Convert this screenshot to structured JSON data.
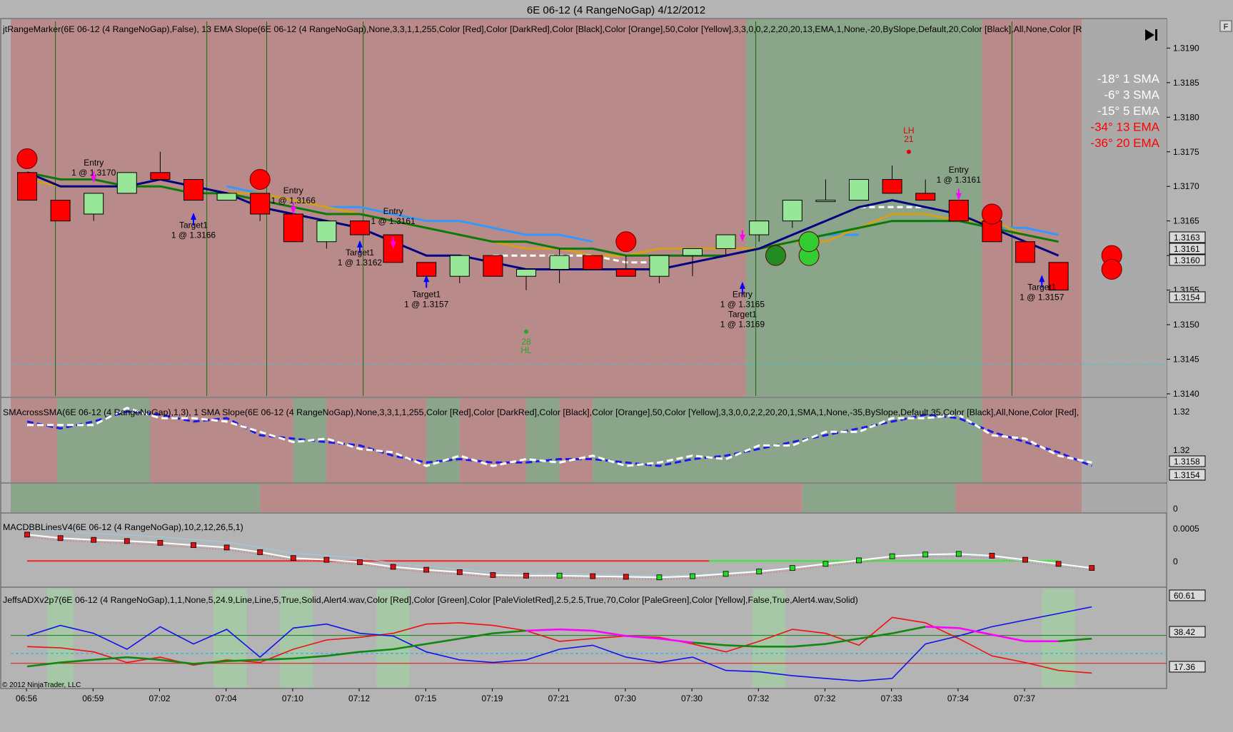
{
  "window": {
    "title": "6E 06-12 (4 RangeNoGap)  4/12/2012",
    "copyright": "© 2012 NinjaTrader, LLC",
    "corner_button": "F"
  },
  "colors": {
    "bg": "#b4b4b4",
    "bear_zone": "#b98a8a",
    "bull_zone": "#8ba58b",
    "gray_zone": "#aaaaaa",
    "up_candle": "#98e698",
    "down_candle": "#ff0000",
    "ema13": "#0a7a0a",
    "ema20": "#d4a017",
    "sma1": "#000080",
    "sma3": "#ffffff",
    "ema5": "#f5a08a",
    "blue_line": "#3399ff",
    "magenta": "#ff00ff",
    "arrow_blue": "#0000ff"
  },
  "chart_data": [
    {
      "panel": "price",
      "type": "candlestick",
      "label": "jtRangeMarker(6E 06-12 (4 RangeNoGap),False),  13 EMA Slope(6E 06-12 (4 RangeNoGap),None,3,3,1,1,255,Color [Red],Color [DarkRed],Color [Black],Color [Orange],50,Color [Yellow],3,3,0,0,2,2,20,20,13,EMA,1,None,-20,BySlope,Default,20,Color [Black],All,None,Color [R",
      "x_ticks": [
        "06:56",
        "06:59",
        "07:02",
        "07:04",
        "07:10",
        "07:12",
        "07:15",
        "07:19",
        "07:21",
        "07:30",
        "07:30",
        "07:32",
        "07:32",
        "07:33",
        "07:34",
        "07:37"
      ],
      "y_ticks": [
        "1.3190",
        "1.3185",
        "1.3180",
        "1.3175",
        "1.3170",
        "1.3165",
        "1.3160",
        "1.3155",
        "1.3150",
        "1.3145",
        "1.3140"
      ],
      "ylim": [
        1.314,
        1.3192
      ],
      "price_flags": [
        "1.3163",
        "1.3161",
        "1.3160",
        "1.3154"
      ],
      "zones": [
        {
          "from": 0,
          "to": 22.1,
          "kind": "bear"
        },
        {
          "from": 22.1,
          "to": 29.2,
          "kind": "bull"
        },
        {
          "from": 29.2,
          "to": 32.2,
          "kind": "bear"
        },
        {
          "from": 32.2,
          "to": 35.0,
          "kind": "gray"
        }
      ],
      "bars": [
        {
          "o": 1.3172,
          "h": 1.3172,
          "l": 1.3168,
          "c": 1.3168
        },
        {
          "o": 1.3168,
          "h": 1.3168,
          "l": 1.3165,
          "c": 1.3165
        },
        {
          "o": 1.3166,
          "h": 1.3169,
          "l": 1.3165,
          "c": 1.3169
        },
        {
          "o": 1.3169,
          "h": 1.3172,
          "l": 1.3169,
          "c": 1.3172
        },
        {
          "o": 1.3172,
          "h": 1.3175,
          "l": 1.3171,
          "c": 1.3171
        },
        {
          "o": 1.3171,
          "h": 1.3171,
          "l": 1.3168,
          "c": 1.3168
        },
        {
          "o": 1.3168,
          "h": 1.3169,
          "l": 1.3168,
          "c": 1.3169
        },
        {
          "o": 1.3169,
          "h": 1.3169,
          "l": 1.3165,
          "c": 1.3166
        },
        {
          "o": 1.3166,
          "h": 1.3166,
          "l": 1.3162,
          "c": 1.3162
        },
        {
          "o": 1.3162,
          "h": 1.3165,
          "l": 1.3161,
          "c": 1.3165
        },
        {
          "o": 1.3165,
          "h": 1.3165,
          "l": 1.3163,
          "c": 1.3163
        },
        {
          "o": 1.3163,
          "h": 1.3163,
          "l": 1.3159,
          "c": 1.3159
        },
        {
          "o": 1.3159,
          "h": 1.3159,
          "l": 1.3157,
          "c": 1.3157
        },
        {
          "o": 1.3157,
          "h": 1.316,
          "l": 1.3156,
          "c": 1.316
        },
        {
          "o": 1.316,
          "h": 1.316,
          "l": 1.3157,
          "c": 1.3157
        },
        {
          "o": 1.3157,
          "h": 1.3158,
          "l": 1.3155,
          "c": 1.3158
        },
        {
          "o": 1.3158,
          "h": 1.3161,
          "l": 1.3156,
          "c": 1.316
        },
        {
          "o": 1.316,
          "h": 1.316,
          "l": 1.3158,
          "c": 1.3158
        },
        {
          "o": 1.3158,
          "h": 1.316,
          "l": 1.3157,
          "c": 1.3157
        },
        {
          "o": 1.3157,
          "h": 1.316,
          "l": 1.3156,
          "c": 1.316
        },
        {
          "o": 1.316,
          "h": 1.3161,
          "l": 1.3157,
          "c": 1.3161
        },
        {
          "o": 1.3161,
          "h": 1.3163,
          "l": 1.316,
          "c": 1.3163
        },
        {
          "o": 1.3163,
          "h": 1.3165,
          "l": 1.3162,
          "c": 1.3165
        },
        {
          "o": 1.3165,
          "h": 1.3168,
          "l": 1.3164,
          "c": 1.3168
        },
        {
          "o": 1.3168,
          "h": 1.3171,
          "l": 1.3168,
          "c": 1.3168
        },
        {
          "o": 1.3168,
          "h": 1.3171,
          "l": 1.3168,
          "c": 1.3171
        },
        {
          "o": 1.3171,
          "h": 1.3173,
          "l": 1.3169,
          "c": 1.3169
        },
        {
          "o": 1.3169,
          "h": 1.3171,
          "l": 1.3168,
          "c": 1.3168
        },
        {
          "o": 1.3168,
          "h": 1.3168,
          "l": 1.3165,
          "c": 1.3165
        },
        {
          "o": 1.3165,
          "h": 1.3165,
          "l": 1.3162,
          "c": 1.3162
        },
        {
          "o": 1.3162,
          "h": 1.3162,
          "l": 1.3159,
          "c": 1.3159
        },
        {
          "o": 1.3159,
          "h": 1.3159,
          "l": 1.3155,
          "c": 1.3155
        }
      ],
      "series": [
        {
          "name": "1 SMA",
          "color": "#000080",
          "style": "solid",
          "values": [
            1.3172,
            1.317,
            1.317,
            1.317,
            1.3171,
            1.317,
            1.3169,
            1.3167,
            1.3166,
            1.3165,
            1.3164,
            1.3162,
            1.316,
            1.316,
            1.3159,
            1.3158,
            1.3158,
            1.3158,
            1.3158,
            1.3158,
            1.3159,
            1.316,
            1.3161,
            1.3163,
            1.3165,
            1.3167,
            1.3168,
            1.3167,
            1.3166,
            1.3164,
            1.3162,
            1.316
          ]
        },
        {
          "name": "3 SMA",
          "color": "#ffffff",
          "style": "dashed",
          "values": [
            null,
            null,
            null,
            null,
            null,
            null,
            null,
            null,
            null,
            null,
            null,
            null,
            null,
            null,
            1.316,
            1.316,
            1.316,
            1.316,
            1.3159,
            1.3159,
            null,
            null,
            null,
            null,
            1.3165,
            1.3167,
            1.3167,
            1.3167,
            1.3166,
            null,
            null,
            null
          ]
        },
        {
          "name": "5 EMA",
          "color": "#f5a08a",
          "style": "dashed",
          "values": [
            null,
            null,
            null,
            null,
            null,
            null,
            null,
            null,
            1.3168,
            1.3167,
            1.3166,
            1.3165,
            1.3164,
            1.3163,
            1.3162,
            1.3161,
            1.3161,
            1.316,
            1.316,
            1.316,
            null,
            null,
            null,
            null,
            null,
            null,
            null,
            null,
            null,
            1.3164,
            1.3163,
            1.3162
          ]
        },
        {
          "name": "13 EMA",
          "color": "#0a7a0a",
          "style": "solid",
          "values": [
            1.3172,
            1.3171,
            1.3171,
            1.317,
            1.317,
            1.3169,
            1.3169,
            1.3168,
            1.3167,
            1.3166,
            1.3166,
            1.3165,
            1.3164,
            1.3163,
            1.3162,
            1.3162,
            1.3161,
            1.3161,
            1.316,
            1.316,
            1.316,
            1.316,
            1.3161,
            1.3162,
            1.3163,
            1.3164,
            1.3165,
            1.3165,
            1.3165,
            1.3164,
            1.3163,
            1.3162
          ]
        },
        {
          "name": "20 EMA",
          "color": "#d4a017",
          "style": "solid",
          "values": [
            1.3171,
            1.317,
            1.317,
            1.317,
            1.317,
            1.3169,
            1.3169,
            1.3169,
            1.3168,
            1.3167,
            1.3166,
            1.3165,
            1.3164,
            1.3163,
            1.3162,
            1.3161,
            1.3161,
            1.316,
            1.316,
            1.3161,
            1.3161,
            1.3161,
            1.3161,
            1.3162,
            1.3162,
            1.3164,
            1.3166,
            1.3166,
            1.3165,
            1.3165,
            1.3163,
            1.3162
          ]
        },
        {
          "name": "slope line",
          "color": "#3399ff",
          "style": "solid",
          "values": [
            null,
            null,
            null,
            null,
            null,
            null,
            1.317,
            1.3169,
            1.3168,
            1.3167,
            1.3167,
            1.3166,
            1.3165,
            1.3165,
            1.3164,
            1.3163,
            1.3163,
            1.3162,
            null,
            null,
            null,
            null,
            null,
            1.3162,
            1.3163,
            1.3163,
            null,
            null,
            null,
            1.3164,
            1.3164,
            1.3163
          ]
        }
      ],
      "circles": [
        {
          "bar": 0,
          "price": 1.3174,
          "color": "#ff0000"
        },
        {
          "bar": 7,
          "price": 1.3171,
          "color": "#ff0000"
        },
        {
          "bar": 18,
          "price": 1.3162,
          "color": "#ff0000"
        },
        {
          "bar": 22.5,
          "price": 1.316,
          "color": "#228b22"
        },
        {
          "bar": 23.5,
          "price": 1.316,
          "color": "#32cd32"
        },
        {
          "bar": 23.5,
          "price": 1.3162,
          "color": "#32cd32"
        },
        {
          "bar": 29,
          "price": 1.3166,
          "color": "#ff0000"
        },
        {
          "bar": 32.6,
          "price": 1.316,
          "color": "#ff0000"
        },
        {
          "bar": 32.6,
          "price": 1.3158,
          "color": "#ff0000"
        }
      ],
      "annotations": [
        {
          "lines": [
            "Entry",
            "1 @ 1.3170"
          ],
          "bar": 2,
          "price": 1.3173
        },
        {
          "lines": [
            "Target1",
            "1 @ 1.3166"
          ],
          "bar": 5,
          "price": 1.3164
        },
        {
          "lines": [
            "Entry",
            "1 @ 1.3166"
          ],
          "bar": 8,
          "price": 1.3169
        },
        {
          "lines": [
            "Target1",
            "1 @ 1.3162"
          ],
          "bar": 10,
          "price": 1.316
        },
        {
          "lines": [
            "Entry",
            "1 @ 1.3161"
          ],
          "bar": 11,
          "price": 1.3166
        },
        {
          "lines": [
            "Target1",
            "1 @ 1.3157"
          ],
          "bar": 12,
          "price": 1.3154
        },
        {
          "lines": [
            "Entry",
            "1 @ 1.3165",
            "Target1",
            "1 @ 1.3169"
          ],
          "bar": 21.5,
          "price": 1.3154
        },
        {
          "lines": [
            "Entry",
            "1 @ 1.3161"
          ],
          "bar": 28,
          "price": 1.3172
        },
        {
          "lines": [
            "Target1",
            "1 @ 1.3157"
          ],
          "bar": 30.5,
          "price": 1.3155
        }
      ],
      "swing_labels": [
        {
          "lines": [
            "LH",
            "21"
          ],
          "bar": 26.5,
          "price": 1.3175,
          "color": "#e00000"
        },
        {
          "lines": [
            "28",
            "HL"
          ],
          "bar": 15,
          "price": 1.3149,
          "color": "#22aa22"
        }
      ],
      "legend": [
        {
          "text": "-18° 1 SMA",
          "color": "#ffffff"
        },
        {
          "text": "-6° 3 SMA",
          "color": "#ffffff"
        },
        {
          "text": "-15°  5 EMA",
          "color": "#ffffff"
        },
        {
          "text": "-34° 13 EMA",
          "color": "#ff0000"
        },
        {
          "text": "-36° 20 EMA",
          "color": "#ff0000"
        }
      ]
    },
    {
      "panel": "sma_cross",
      "type": "line",
      "label": "SMAcrossSMA(6E 06-12 (4 RangeNoGap),1,3),  1 SMA Slope(6E 06-12 (4 RangeNoGap),None,3,3,1,1,255,Color [Red],Color [DarkRed],Color [Black],Color [Orange],50,Color [Yellow],3,3,0,0,2,2,20,20,1,SMA,1,None,-35,BySlope,Default,35,Color [Black],All,None,Color [Red],",
      "y_ticks": [
        "1.32",
        "1.32"
      ],
      "price_flags": [
        "1.3158",
        "1.3154"
      ]
    },
    {
      "panel": "zone_strip",
      "type": "area",
      "y_ticks": [
        "0"
      ]
    },
    {
      "panel": "macd",
      "type": "line",
      "label": "MACDBBLinesV4(6E 06-12 (4 RangeNoGap),10,2,12,26,5,1)",
      "y_ticks": [
        "0.0005",
        "0"
      ],
      "ylim": [
        -0.00035,
        0.0006
      ],
      "macd": [
        0.00045,
        0.00039,
        0.00036,
        0.00034,
        0.00031,
        0.00027,
        0.00023,
        0.00015,
        5e-05,
        2e-05,
        -2e-05,
        -0.0001,
        -0.00015,
        -0.00019,
        -0.00024,
        -0.00025,
        -0.00025,
        -0.00026,
        -0.00027,
        -0.00028,
        -0.00026,
        -0.00022,
        -0.00018,
        -0.00012,
        -5e-05,
        1e-05,
        8e-05,
        0.00011,
        0.00012,
        9e-05,
        2e-05,
        -5e-05,
        -0.00012
      ],
      "dot_colors": [
        "r",
        "r",
        "r",
        "r",
        "r",
        "r",
        "r",
        "r",
        "r",
        "r",
        "r",
        "r",
        "r",
        "r",
        "r",
        "r",
        "g",
        "r",
        "r",
        "g",
        "g",
        "g",
        "g",
        "g",
        "g",
        "g",
        "g",
        "g",
        "g",
        "r",
        "r",
        "r",
        "r"
      ]
    },
    {
      "panel": "adx",
      "type": "line",
      "label": "JeffsADXv2p7(6E 06-12 (4 RangeNoGap),1,1,None,5,24.9,Line,Line,5,True,Solid,Alert4.wav,Color [Red],Color [Green],Color [PaleVioletRed],2.5,2.5,True,70,Color [PaleGreen],Color [Yellow],False,True,Alert4.wav,Solid)",
      "y_ticks": [
        "60.61",
        "38.42",
        "17.36"
      ],
      "ylim": [
        0,
        70
      ],
      "levels": {
        "upper": 38.42,
        "lower": 17.36,
        "mid": 24.9
      }
    }
  ]
}
